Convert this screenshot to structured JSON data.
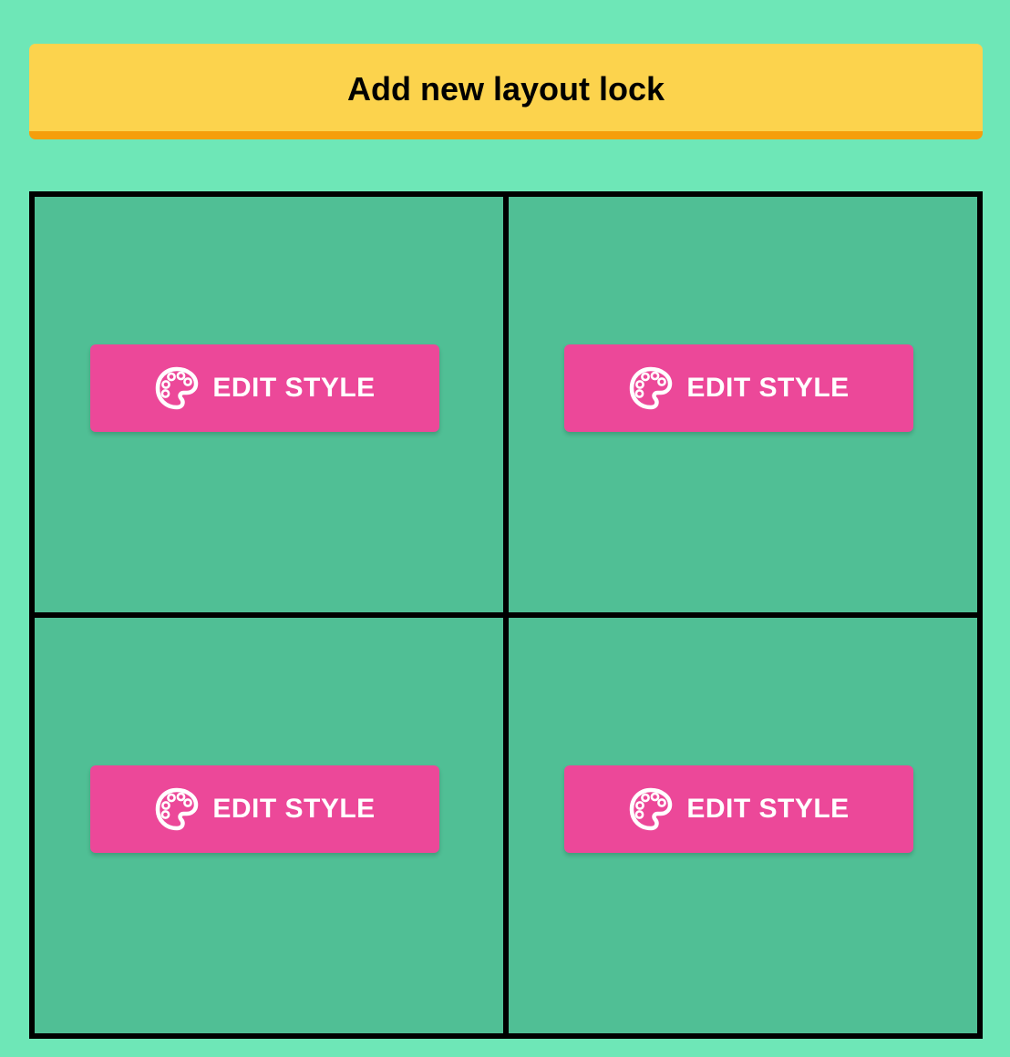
{
  "header": {
    "add_button_label": "Add new layout lock"
  },
  "grid": {
    "cells": [
      {
        "edit_button": {
          "label": "EDIT STYLE",
          "icon": "palette-icon"
        }
      },
      {
        "edit_button": {
          "label": "EDIT STYLE",
          "icon": "palette-icon"
        }
      },
      {
        "edit_button": {
          "label": "EDIT STYLE",
          "icon": "palette-icon"
        }
      },
      {
        "edit_button": {
          "label": "EDIT STYLE",
          "icon": "palette-icon"
        }
      }
    ]
  },
  "colors": {
    "page_background": "#6EE7B7",
    "add_button": "#FCD34D",
    "add_button_border": "#F59E0B",
    "cell_background": "#50BF95",
    "grid_border": "#000000",
    "edit_button": "#EC4899",
    "edit_button_text": "#FFFFFF"
  }
}
